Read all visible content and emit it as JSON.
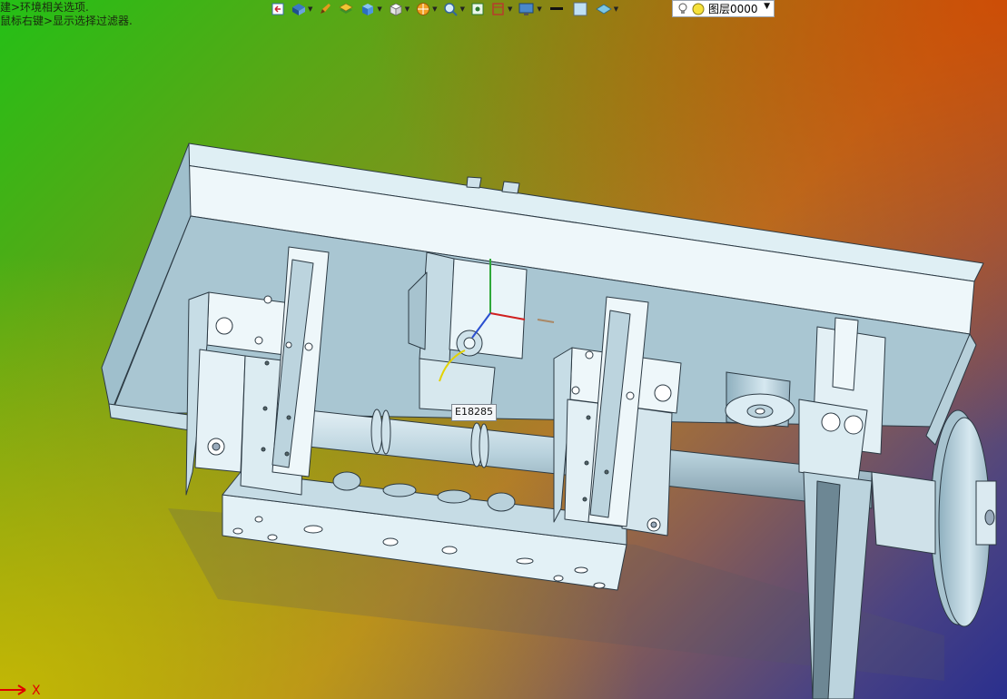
{
  "viewport": {
    "hint_lines": [
      "建>环境相关选项.",
      "鼠标右键>显示选择过滤器."
    ],
    "entity_tag": "E18285",
    "axis_label": "X"
  },
  "toolbar": {
    "items": [
      {
        "icon": "return-icon",
        "has_dropdown": false
      },
      {
        "icon": "view-orient-icon",
        "has_dropdown": true
      },
      {
        "icon": "pen-icon",
        "has_dropdown": false
      },
      {
        "icon": "layers-icon",
        "has_dropdown": false
      },
      {
        "icon": "cube-blue-icon",
        "has_dropdown": true
      },
      {
        "icon": "cube-white-icon",
        "has_dropdown": true
      },
      {
        "icon": "section-icon",
        "has_dropdown": true
      },
      {
        "icon": "zoom-icon",
        "has_dropdown": true
      },
      {
        "icon": "fit-icon",
        "has_dropdown": false
      },
      {
        "icon": "frame-icon",
        "has_dropdown": true
      },
      {
        "icon": "monitor-icon",
        "has_dropdown": true
      },
      {
        "icon": "line-color-icon",
        "has_dropdown": false
      },
      {
        "icon": "fill-color-icon",
        "has_dropdown": false
      },
      {
        "icon": "plane-icon",
        "has_dropdown": true
      }
    ]
  },
  "layer_selector": {
    "value": "图层0000",
    "icons": [
      "bulb-icon",
      "sun-icon"
    ]
  },
  "colors": {
    "part": "#dfeff4",
    "part_shade": "#a9c6d2",
    "part_edge": "#2c3a44",
    "background_top_left": "#23c016",
    "background_top_right": "#c8520a",
    "background_bottom_left": "#cfc000",
    "background_bottom_right": "#2a2f8e"
  }
}
